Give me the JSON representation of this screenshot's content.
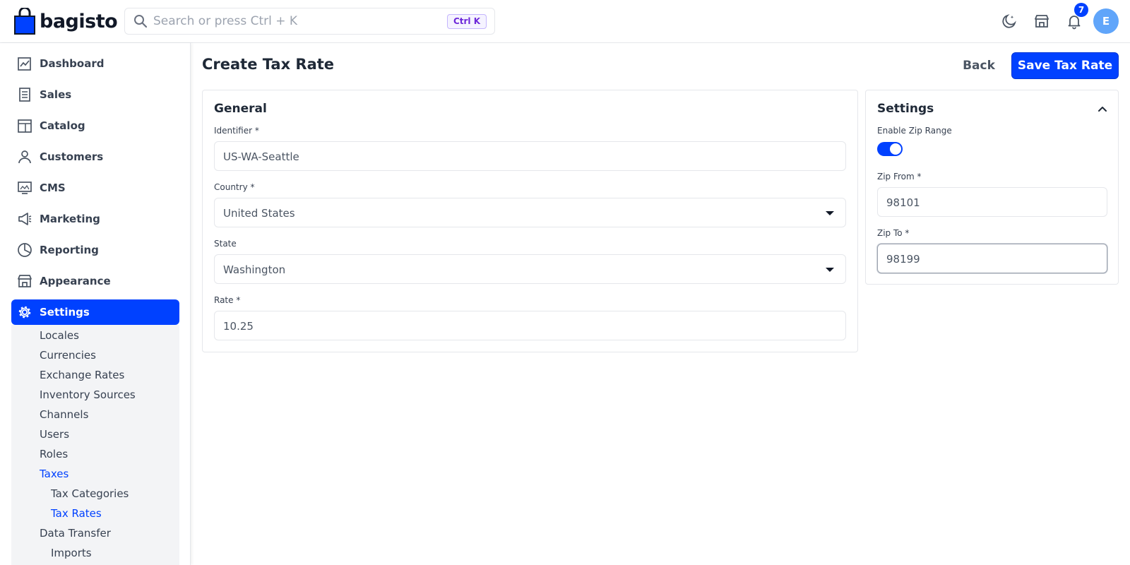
{
  "app": {
    "brand": "bagisto"
  },
  "header": {
    "search_placeholder": "Search or press Ctrl + K",
    "search_shortcut": "Ctrl K",
    "notification_count": "7",
    "avatar_initial": "E"
  },
  "sidebar": {
    "items": [
      {
        "label": "Dashboard",
        "icon": "dashboard-icon"
      },
      {
        "label": "Sales",
        "icon": "receipt-icon"
      },
      {
        "label": "Catalog",
        "icon": "catalog-icon"
      },
      {
        "label": "Customers",
        "icon": "user-icon"
      },
      {
        "label": "CMS",
        "icon": "monitor-icon"
      },
      {
        "label": "Marketing",
        "icon": "megaphone-icon"
      },
      {
        "label": "Reporting",
        "icon": "pie-chart-icon"
      },
      {
        "label": "Appearance",
        "icon": "store-icon"
      },
      {
        "label": "Settings",
        "icon": "gear-icon"
      }
    ],
    "active": "Settings",
    "settings_children": [
      "Locales",
      "Currencies",
      "Exchange Rates",
      "Inventory Sources",
      "Channels",
      "Users",
      "Roles",
      "Taxes",
      "Tax Categories",
      "Tax Rates",
      "Data Transfer",
      "Imports"
    ]
  },
  "page": {
    "title": "Create Tax Rate",
    "back_label": "Back",
    "save_label": "Save Tax Rate"
  },
  "general": {
    "title": "General",
    "identifier_label": "Identifier *",
    "identifier_value": "US-WA-Seattle",
    "country_label": "Country *",
    "country_value": "United States",
    "state_label": "State",
    "state_value": "Washington",
    "rate_label": "Rate *",
    "rate_value": "10.25"
  },
  "settings_card": {
    "title": "Settings",
    "zip_range_label": "Enable Zip Range",
    "zip_range_enabled": true,
    "zip_from_label": "Zip From *",
    "zip_from_value": "98101",
    "zip_to_label": "Zip To *",
    "zip_to_value": "98199"
  },
  "colors": {
    "accent": "#0041ff",
    "avatar": "#60a5fa",
    "sidebar_submenu_bg": "#f3f4f6"
  }
}
